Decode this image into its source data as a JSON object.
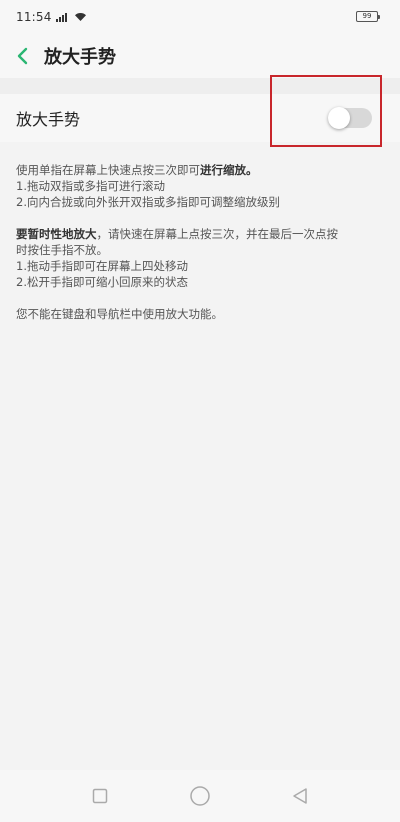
{
  "status_bar": {
    "time": "11:54",
    "battery": "99"
  },
  "header": {
    "title": "放大手势"
  },
  "setting": {
    "label": "放大手势",
    "toggle_on": false
  },
  "description": {
    "para1_line1_normal": "使用单指在屏幕上快速点按三次即可",
    "para1_line1_bold": "进行缩放。",
    "para1_line2": "1.拖动双指或多指可进行滚动",
    "para1_line3": "2.向内合拢或向外张开双指或多指即可调整缩放级别",
    "para2_line1_bold": "要暂时性地放大",
    "para2_line1_normal": "，请快速在屏幕上点按三次，并在最后一次点按",
    "para2_line2": "时按住手指不放。",
    "para2_line3": "1.拖动手指即可在屏幕上四处移动",
    "para2_line4": "2.松开手指即可缩小回原来的状态",
    "para3": "您不能在键盘和导航栏中使用放大功能。"
  },
  "colors": {
    "accent": "#2bb673",
    "highlight": "#c8262b"
  },
  "icons": {
    "back": "chevron-left-icon",
    "recent": "square-icon",
    "home": "circle-icon",
    "back_nav": "triangle-left-icon"
  }
}
